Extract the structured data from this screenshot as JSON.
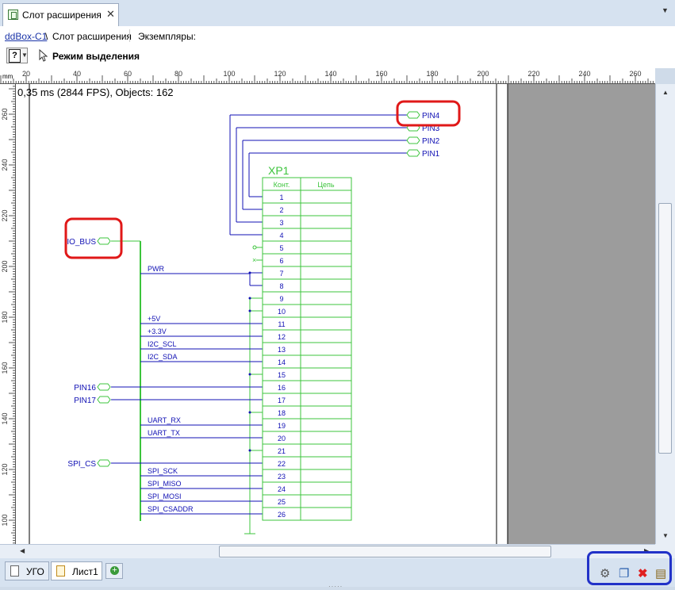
{
  "tabs": [
    {
      "title": "Слот расширения",
      "close": "✕"
    }
  ],
  "breadcrumb": {
    "link": "ddBox-C1",
    "separator": "\\",
    "current": "Слот расширения",
    "instances": "Экземпляры:"
  },
  "toolbar": {
    "help": "?",
    "mode": "Режим выделения"
  },
  "hruler": {
    "unit": "mm",
    "ticks": [
      "20",
      "40",
      "60",
      "80",
      "100",
      "120",
      "140",
      "160",
      "180",
      "200",
      "220",
      "240",
      "260"
    ]
  },
  "vruler": {
    "ticks": [
      "260",
      "240",
      "220",
      "200",
      "180",
      "160",
      "140",
      "120",
      "100"
    ]
  },
  "stats": "0,35 ms (2844 FPS), Objects: 162",
  "component": {
    "ref": "XP1",
    "col1": "Конт.",
    "col2": "Цепь",
    "pins": [
      "1",
      "2",
      "3",
      "4",
      "5",
      "6",
      "7",
      "8",
      "9",
      "10",
      "11",
      "12",
      "13",
      "14",
      "15",
      "16",
      "17",
      "18",
      "19",
      "20",
      "21",
      "22",
      "23",
      "24",
      "25",
      "26"
    ]
  },
  "ports_right": [
    "PIN4",
    "PIN3",
    "PIN2",
    "PIN1"
  ],
  "ports_left": [
    "IO_BUS",
    "PIN16",
    "PIN17",
    "SPI_CS"
  ],
  "nets": [
    "PWR",
    "+5V",
    "+3.3V",
    "I2C_SCL",
    "I2C_SDA",
    "UART_RX",
    "UART_TX",
    "SPI_SCK",
    "SPI_MISO",
    "SPI_MOSI",
    "SPI_CSADDR"
  ],
  "bottom_tabs": [
    "УГО",
    "Лист1"
  ],
  "colors": {
    "schematic_green": "#3cc43c",
    "wire_blue": "#1010b4",
    "highlight_red": "#e01818",
    "highlight_blue": "#2232c8"
  },
  "icons": [
    "settings-icon",
    "windows-icon",
    "delete-icon",
    "properties-icon"
  ]
}
